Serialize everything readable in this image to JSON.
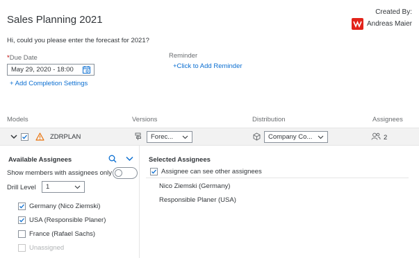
{
  "header": {
    "title": "Sales Planning 2021",
    "created_by_label": "Created By:",
    "creator_name": "Andreas Maier"
  },
  "intro_text": "Hi, could you please enter the forecast for 2021?",
  "due_date": {
    "required_mark": "*",
    "label": "Due Date",
    "value": "May 29, 2020 - 18:00"
  },
  "add_completion_label": "+ Add Completion Settings",
  "reminder": {
    "label": "Reminder",
    "add_label": "+Click to Add Reminder"
  },
  "columns": {
    "models": "Models",
    "versions": "Versions",
    "distribution": "Distribution",
    "assignees": "Assignees"
  },
  "model_row": {
    "name": "ZDRPLAN",
    "version": "Forec...",
    "distribution": "Company Co...",
    "assignee_count": "2"
  },
  "available": {
    "title": "Available Assignees",
    "show_members_label": "Show members with assignees only",
    "drill_level_label": "Drill Level",
    "drill_level_value": "1",
    "items": [
      {
        "label": "Germany (Nico Ziemski)",
        "checked": true,
        "disabled": false
      },
      {
        "label": "USA (Responsible Planer)",
        "checked": true,
        "disabled": false
      },
      {
        "label": "France (Rafael Sachs)",
        "checked": false,
        "disabled": false
      },
      {
        "label": "Unassigned",
        "checked": false,
        "disabled": true
      }
    ]
  },
  "selected": {
    "title": "Selected Assignees",
    "can_see_label": "Assignee can see other assignees",
    "items": [
      "Nico Ziemski (Germany)",
      "Responsible Planer (USA)"
    ]
  },
  "colors": {
    "accent": "#0a6ed1",
    "warning": "#e9730c",
    "brand_red": "#e2231a"
  }
}
